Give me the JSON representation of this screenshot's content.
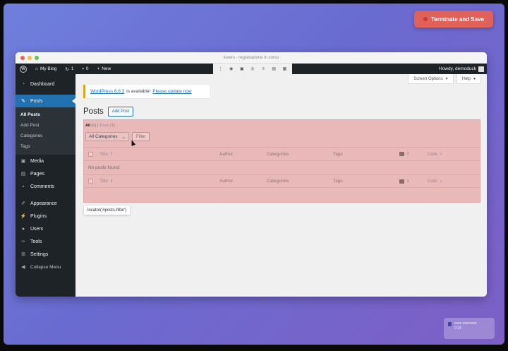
{
  "overlay": {
    "terminate_label": "Terminate and Save",
    "mini_card_lines": [
      "xxxx-xxxxxxxx",
      "0:18"
    ]
  },
  "browser": {
    "title": "lovers - registrazione in corso"
  },
  "adminbar": {
    "site_name": "My Blog",
    "updates_count": "1",
    "comments_count": "0",
    "new_label": "New",
    "howdy": "Howdy, demoduck"
  },
  "sidebar": {
    "items": [
      {
        "label": "Dashboard",
        "icon": "dashboard-icon"
      },
      {
        "label": "Posts",
        "icon": "pin-icon"
      },
      {
        "label": "Media",
        "icon": "media-icon"
      },
      {
        "label": "Pages",
        "icon": "pages-icon"
      },
      {
        "label": "Comments",
        "icon": "comments-icon"
      },
      {
        "label": "Appearance",
        "icon": "brush-icon"
      },
      {
        "label": "Plugins",
        "icon": "plugin-icon"
      },
      {
        "label": "Users",
        "icon": "users-icon"
      },
      {
        "label": "Tools",
        "icon": "wrench-icon"
      },
      {
        "label": "Settings",
        "icon": "settings-icon"
      },
      {
        "label": "Collapse Menu",
        "icon": "collapse-icon"
      }
    ],
    "submenu": [
      "All Posts",
      "Add Post",
      "Categories",
      "Tags"
    ]
  },
  "screen_meta": {
    "screen_options": "Screen Options",
    "help": "Help"
  },
  "notice": {
    "version_link": "WordPress 6.8.3",
    "middle_text": "is available!",
    "update_link": "Please update now"
  },
  "page": {
    "title": "Posts",
    "add_post": "Add Post"
  },
  "filter": {
    "all_label": "All",
    "all_count": "(0)",
    "trash_label": "Trash",
    "trash_count": "(7)",
    "category_select": "All Categories",
    "filter_button": "Filter"
  },
  "table": {
    "columns": [
      "Title",
      "Author",
      "Categories",
      "Tags",
      "Date"
    ],
    "empty_message": "No posts found."
  },
  "tooltip": {
    "text": "locator('#posts-filter')"
  },
  "colors": {
    "admin_dark": "#1d2327",
    "wp_blue": "#2271b1",
    "highlight": "#e9b8b8",
    "terminate": "#e0605a"
  }
}
